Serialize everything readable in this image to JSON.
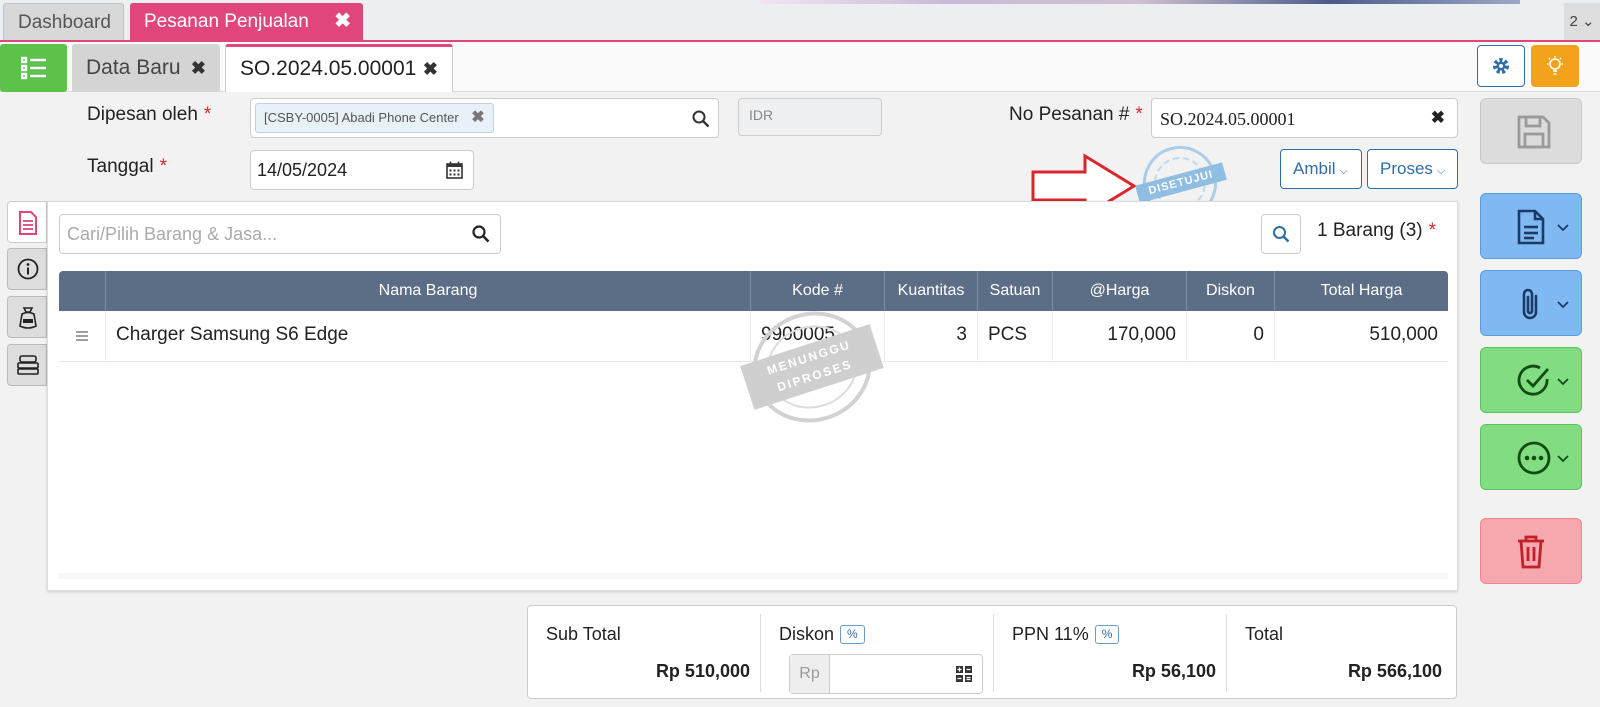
{
  "top_tabs": {
    "dashboard": "Dashboard",
    "pesanan": "Pesanan Penjualan",
    "close": "✖",
    "more": "2 ⌄"
  },
  "sub_tabs": {
    "data_baru": "Data Baru",
    "so": "SO.2024.05.00001",
    "close": "✖"
  },
  "form": {
    "dipesan_label": "Dipesan oleh",
    "required_mark": "*",
    "customer_chip": "[CSBY-0005] Abadi Phone Center",
    "chip_close": "✖",
    "currency": "IDR",
    "no_pesanan_label": "No Pesanan #",
    "no_pesanan_value": "SO.2024.05.00001",
    "no_pesanan_clear": "✖",
    "tanggal_label": "Tanggal",
    "tanggal_value": "14/05/2024",
    "ambil_label": "Ambil",
    "proses_label": "Proses"
  },
  "stamps": {
    "approved": "DISETUJUI",
    "waiting_line1": "MENUNGGU",
    "waiting_line2": "DIPROSES"
  },
  "items": {
    "search_placeholder": "Cari/Pilih Barang & Jasa...",
    "count_label": "1 Barang (3)",
    "required_mark": "*",
    "columns": [
      "Nama Barang",
      "Kode #",
      "Kuantitas",
      "Satuan",
      "@Harga",
      "Diskon",
      "Total Harga"
    ],
    "rows": [
      {
        "nama": "Charger Samsung S6 Edge",
        "kode": "9900005",
        "qty": "3",
        "satuan": "PCS",
        "harga": "170,000",
        "diskon": "0",
        "total": "510,000"
      }
    ]
  },
  "totals": {
    "subtotal_label": "Sub Total",
    "subtotal_value": "Rp 510,000",
    "diskon_label": "Diskon",
    "diskon_prefix": "Rp",
    "pct": "%",
    "ppn_label": "PPN 11%",
    "ppn_value": "Rp 56,100",
    "total_label": "Total",
    "total_value": "Rp 566,100"
  },
  "colors": {
    "accent_pink": "#e0457b",
    "menu_green": "#5cc24a",
    "header_slate": "#5b6e86",
    "blue_action": "#80b8f2",
    "green_action": "#82dc82",
    "red_action": "#f6a8ae"
  },
  "icons": [
    "list-icon",
    "gear-icon",
    "lightbulb-icon",
    "search-icon",
    "calendar-icon",
    "save-icon",
    "document-icon",
    "paperclip-icon",
    "check-circle-icon",
    "more-circle-icon",
    "trash-icon",
    "info-icon",
    "money-icon",
    "stack-icon",
    "calculator-icon",
    "drag-handle-icon"
  ]
}
